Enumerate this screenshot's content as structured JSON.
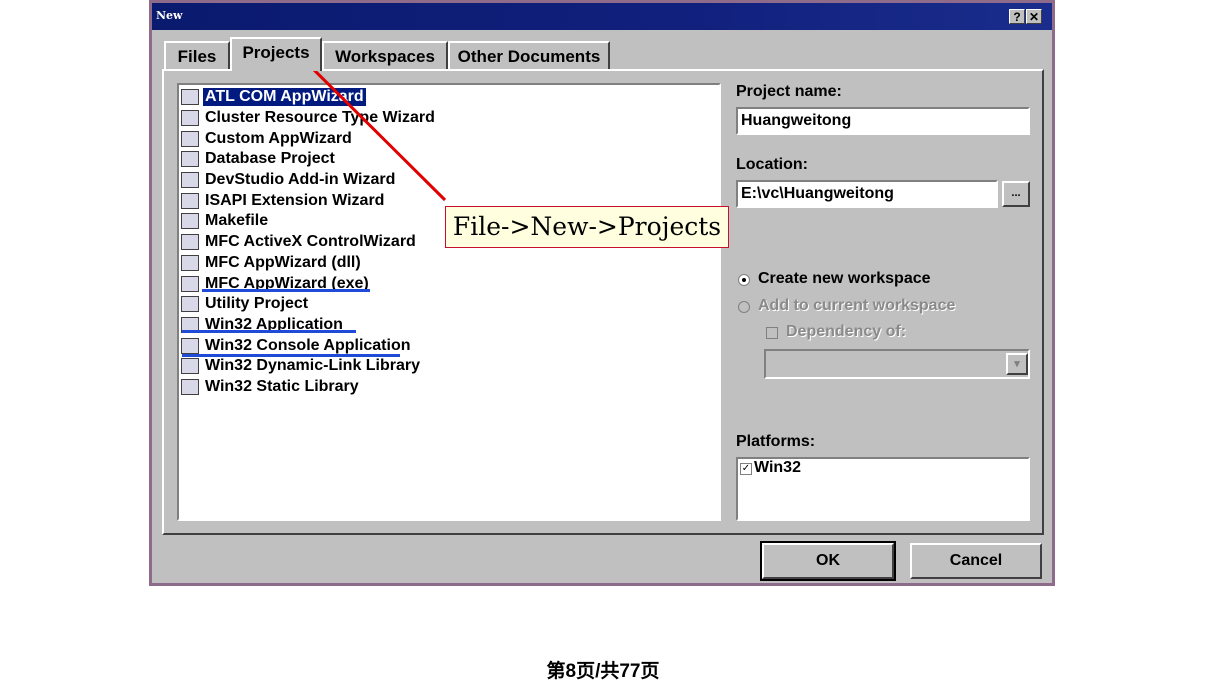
{
  "window": {
    "title": "New",
    "help_button": "?",
    "close_button": "✕"
  },
  "tabs": [
    {
      "label": "Files"
    },
    {
      "label": "Projects"
    },
    {
      "label": "Workspaces"
    },
    {
      "label": "Other Documents"
    }
  ],
  "project_types": [
    {
      "label": "ATL COM AppWizard",
      "icon": "atl-icon",
      "selected": true
    },
    {
      "label": "Cluster Resource Type Wizard",
      "icon": "cluster-icon"
    },
    {
      "label": "Custom AppWizard",
      "icon": "custom-wizard-icon"
    },
    {
      "label": "Database Project",
      "icon": "database-icon"
    },
    {
      "label": "DevStudio Add-in Wizard",
      "icon": "addin-icon"
    },
    {
      "label": "ISAPI Extension Wizard",
      "icon": "globe-icon"
    },
    {
      "label": "Makefile",
      "icon": "makefile-icon"
    },
    {
      "label": "MFC ActiveX ControlWizard",
      "icon": "activex-icon"
    },
    {
      "label": "MFC AppWizard (dll)",
      "icon": "mfc-dll-icon"
    },
    {
      "label": "MFC AppWizard (exe)",
      "icon": "mfc-exe-icon"
    },
    {
      "label": "Utility Project",
      "icon": "utility-icon"
    },
    {
      "label": "Win32 Application",
      "icon": "win32-app-icon"
    },
    {
      "label": "Win32 Console Application",
      "icon": "console-icon"
    },
    {
      "label": "Win32 Dynamic-Link Library",
      "icon": "dll-icon"
    },
    {
      "label": "Win32 Static Library",
      "icon": "static-lib-icon"
    }
  ],
  "right_panel": {
    "project_name_label": "Project name:",
    "project_name_value": "Huangweitong",
    "location_label": "Location:",
    "location_value": "E:\\vc\\Huangweitong",
    "browse_button": "...",
    "create_new_workspace": "Create new workspace",
    "add_to_current_workspace": "Add to current workspace",
    "dependency_of": "Dependency of:",
    "platforms_label": "Platforms:",
    "platforms": [
      {
        "label": "Win32",
        "checked": true
      }
    ]
  },
  "buttons": {
    "ok": "OK",
    "cancel": "Cancel"
  },
  "annotation": {
    "text": "File->New->Projects",
    "color": "#e00000"
  },
  "footer": {
    "page_text": "第8页/共77页"
  }
}
